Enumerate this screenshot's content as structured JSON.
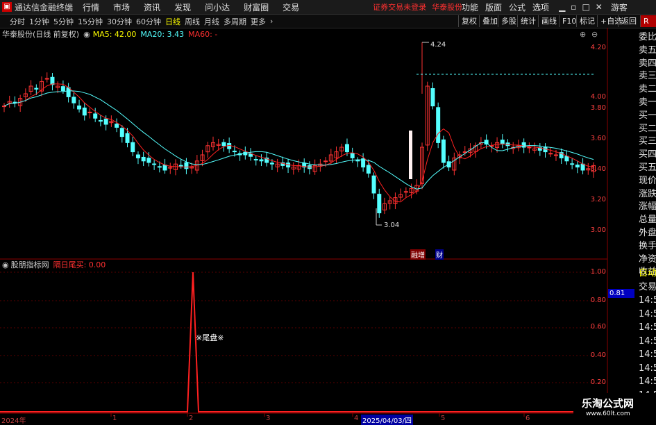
{
  "menubar": {
    "app_title": "通达信金融终端",
    "items": [
      "行情",
      "市场",
      "资讯",
      "发现",
      "问小达",
      "财富圈",
      "交易"
    ],
    "status": "证券交易未登录",
    "stock": "华泰股份",
    "right_items": [
      "功能",
      "版面",
      "公式",
      "选项"
    ],
    "guest": "游客"
  },
  "period_bar": {
    "periods": [
      "分时",
      "1分钟",
      "5分钟",
      "15分钟",
      "30分钟",
      "60分钟",
      "日线",
      "周线",
      "月线",
      "多周期",
      "更多"
    ],
    "active": "日线",
    "right_buttons": [
      "复权",
      "叠加",
      "多股",
      "统计",
      "画线",
      "F10",
      "标记",
      "+自选",
      "返回"
    ]
  },
  "main_chart": {
    "title": "华泰股份(日线 前复权)",
    "ma5": "MA5: 42.00",
    "ma20": "MA20: 3.43",
    "ma60": "MA60: -",
    "y_labels": [
      "4.20",
      "4.00",
      "3.80",
      "3.60",
      "3.40",
      "3.20",
      "3.00"
    ],
    "annotation_high": "4.24",
    "annotation_low": "3.04",
    "tags": [
      "融增",
      "财"
    ]
  },
  "indicator_panel": {
    "title": "股朋指标网",
    "line_label": "隔日尾买: 0.00",
    "marker": "※尾盘※",
    "y_labels": [
      "1.00",
      "0.80",
      "0.60",
      "0.40",
      "0.20"
    ],
    "current_value": "0.81"
  },
  "x_axis": {
    "labels": [
      "2024年",
      "1",
      "2",
      "3",
      "4",
      "2025/04/03/四",
      "5",
      "6"
    ]
  },
  "side_panel": {
    "items": [
      "委比",
      "卖五",
      "卖四",
      "卖三",
      "卖二",
      "卖一",
      "买一",
      "买二",
      "买三",
      "买四",
      "买五",
      "现价",
      "涨跌",
      "涨幅",
      "总量",
      "外盘",
      "换手",
      "净资",
      "收益"
    ],
    "lower_items": [
      "自动",
      "交易",
      "14:56",
      "14:56",
      "14:56",
      "14:56",
      "14:56",
      "14:56",
      "14:56",
      "14:56"
    ]
  },
  "colors": {
    "up": "#ff3232",
    "down": "#54ffff",
    "ma5": "#ffffff",
    "ma20": "#54ffff",
    "grid": "#8b0000"
  }
}
